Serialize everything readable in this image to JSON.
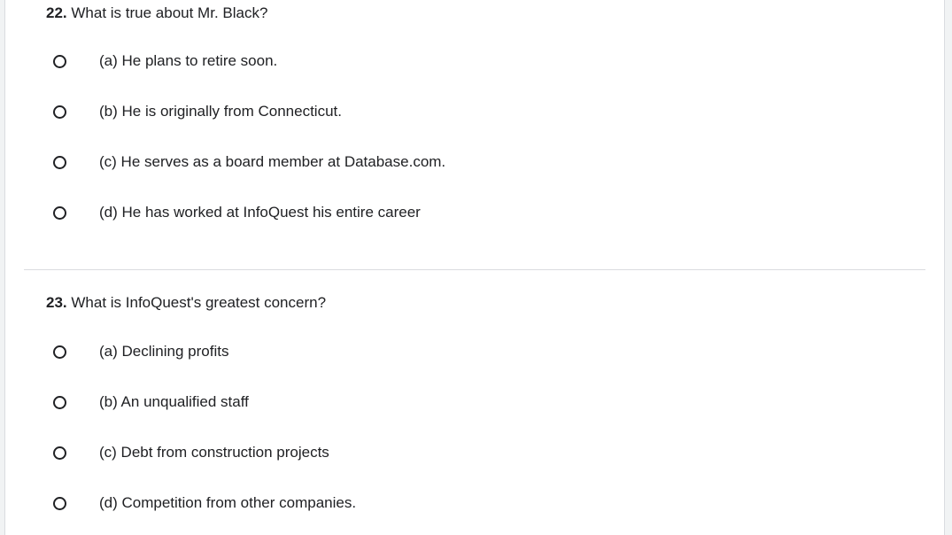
{
  "questions": [
    {
      "number": "22.",
      "text": "What is true about Mr. Black?",
      "options": [
        "(a) He plans to retire soon.",
        "(b) He is originally from Connecticut.",
        "(c) He serves as a board member at Database.com.",
        "(d) He has worked at InfoQuest his entire career"
      ]
    },
    {
      "number": "23.",
      "text": "What is InfoQuest's greatest concern?",
      "options": [
        "(a) Declining profits",
        "(b) An unqualified staff",
        "(c) Debt from construction projects",
        "(d) Competition from other companies."
      ]
    }
  ]
}
